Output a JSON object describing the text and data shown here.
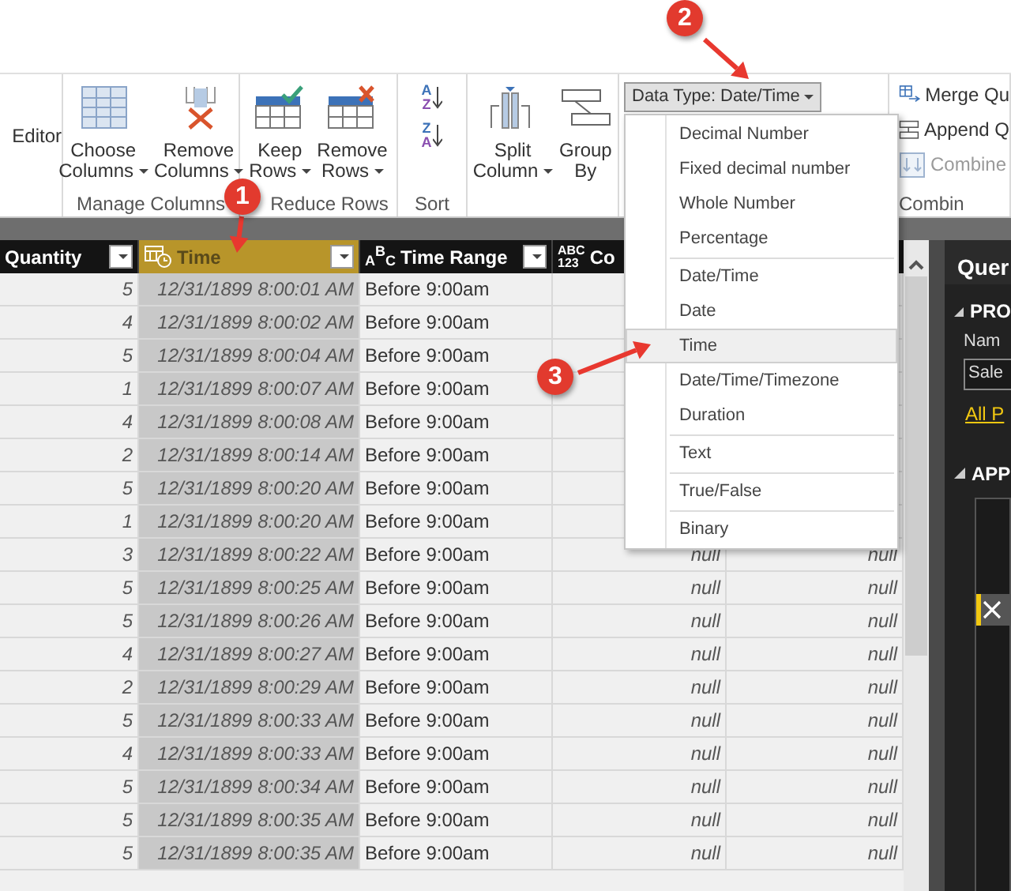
{
  "ribbon": {
    "editor_label": "Editor",
    "groups": [
      {
        "kind": "buttons",
        "label": "Manage Columns",
        "buttons": [
          {
            "kind": "choose-columns",
            "lines": [
              "Choose",
              "Columns"
            ],
            "dropdown": true
          },
          {
            "kind": "remove-columns",
            "lines": [
              "Remove",
              "Columns"
            ],
            "dropdown": true
          }
        ]
      },
      {
        "kind": "buttons",
        "label": "Reduce Rows",
        "buttons": [
          {
            "kind": "keep-rows",
            "lines": [
              "Keep",
              "Rows"
            ],
            "dropdown": true
          },
          {
            "kind": "remove-rows",
            "lines": [
              "Remove",
              "Rows"
            ],
            "dropdown": true
          }
        ]
      },
      {
        "kind": "sort",
        "label": "Sort",
        "buttons": [
          {
            "top": "A",
            "bottom": "Z"
          },
          {
            "top": "Z",
            "bottom": "A"
          }
        ]
      },
      {
        "kind": "buttons",
        "buttons": [
          {
            "kind": "split-column",
            "lines": [
              "Split",
              "Column"
            ],
            "dropdown": true
          },
          {
            "kind": "group-by",
            "lines": [
              "Group",
              "By"
            ],
            "dropdown": false
          }
        ]
      },
      {
        "kind": "data-type",
        "label": "Data Type: Date/Time",
        "open": true,
        "menu": [
          {
            "items": [
              {
                "label": "Decimal Number",
                "selected": false
              },
              {
                "label": "Fixed decimal number",
                "selected": false
              },
              {
                "label": "Whole Number",
                "selected": false
              },
              {
                "label": "Percentage",
                "selected": false
              }
            ]
          },
          {
            "items": [
              {
                "label": "Date/Time",
                "selected": false
              },
              {
                "label": "Date",
                "selected": false
              },
              {
                "label": "Time",
                "selected": true
              },
              {
                "label": "Date/Time/Timezone",
                "selected": false
              },
              {
                "label": "Duration",
                "selected": false
              }
            ]
          },
          {
            "items": [
              {
                "label": "Text",
                "selected": false
              }
            ]
          },
          {
            "items": [
              {
                "label": "True/False",
                "selected": false
              }
            ]
          },
          {
            "items": [
              {
                "label": "Binary",
                "selected": false
              }
            ]
          }
        ]
      },
      {
        "kind": "list",
        "label": "Combin",
        "items": [
          {
            "kind": "merge",
            "label": "Merge Qu",
            "disabled": false
          },
          {
            "kind": "append",
            "label": "Append Q",
            "disabled": false
          },
          {
            "kind": "combine",
            "label": "Combine",
            "disabled": true
          }
        ]
      }
    ]
  },
  "table": {
    "columns": [
      {
        "label": "Quantity",
        "kind": "none",
        "selected": false
      },
      {
        "label": "Time",
        "kind": "time",
        "selected": true
      },
      {
        "label": "Time Range",
        "kind": "text",
        "type_label": [
          "A",
          "B",
          "C"
        ],
        "selected": false
      },
      {
        "label": "Co",
        "kind": "any",
        "type_label": [
          "ABC",
          "123"
        ],
        "selected": false
      }
    ],
    "rows": [
      {
        "quantity": "5",
        "time": "12/31/1899 8:00:01 AM",
        "time_range": "Before 9:00am"
      },
      {
        "quantity": "4",
        "time": "12/31/1899 8:00:02 AM",
        "time_range": "Before 9:00am"
      },
      {
        "quantity": "5",
        "time": "12/31/1899 8:00:04 AM",
        "time_range": "Before 9:00am"
      },
      {
        "quantity": "1",
        "time": "12/31/1899 8:00:07 AM",
        "time_range": "Before 9:00am"
      },
      {
        "quantity": "4",
        "time": "12/31/1899 8:00:08 AM",
        "time_range": "Before 9:00am"
      },
      {
        "quantity": "2",
        "time": "12/31/1899 8:00:14 AM",
        "time_range": "Before 9:00am"
      },
      {
        "quantity": "5",
        "time": "12/31/1899 8:00:20 AM",
        "time_range": "Before 9:00am"
      },
      {
        "quantity": "1",
        "time": "12/31/1899 8:00:20 AM",
        "time_range": "Before 9:00am"
      },
      {
        "quantity": "3",
        "time": "12/31/1899 8:00:22 AM",
        "time_range": "Before 9:00am",
        "column_4": "null",
        "column_5": "null"
      },
      {
        "quantity": "5",
        "time": "12/31/1899 8:00:25 AM",
        "time_range": "Before 9:00am",
        "column_4": "null",
        "column_5": "null"
      },
      {
        "quantity": "5",
        "time": "12/31/1899 8:00:26 AM",
        "time_range": "Before 9:00am",
        "column_4": "null",
        "column_5": "null"
      },
      {
        "quantity": "4",
        "time": "12/31/1899 8:00:27 AM",
        "time_range": "Before 9:00am",
        "column_4": "null",
        "column_5": "null"
      },
      {
        "quantity": "2",
        "time": "12/31/1899 8:00:29 AM",
        "time_range": "Before 9:00am",
        "column_4": "null",
        "column_5": "null"
      },
      {
        "quantity": "5",
        "time": "12/31/1899 8:00:33 AM",
        "time_range": "Before 9:00am",
        "column_4": "null",
        "column_5": "null"
      },
      {
        "quantity": "4",
        "time": "12/31/1899 8:00:33 AM",
        "time_range": "Before 9:00am",
        "column_4": "null",
        "column_5": "null"
      },
      {
        "quantity": "5",
        "time": "12/31/1899 8:00:34 AM",
        "time_range": "Before 9:00am",
        "column_4": "null",
        "column_5": "null"
      },
      {
        "quantity": "5",
        "time": "12/31/1899 8:00:35 AM",
        "time_range": "Before 9:00am",
        "column_4": "null",
        "column_5": "null"
      },
      {
        "quantity": "5",
        "time": "12/31/1899 8:00:35 AM",
        "time_range": "Before 9:00am",
        "column_4": "null",
        "column_5": "null"
      }
    ]
  },
  "query_pane": {
    "title": "Quer",
    "sections": [
      {
        "label": "PRO",
        "expanded": true,
        "name_label": "Nam",
        "name_value": "Sale",
        "link": "All P"
      },
      {
        "label": "APP",
        "expanded": true,
        "steps": [
          {
            "selected": true
          }
        ]
      }
    ]
  },
  "annotations": [
    {
      "label": "1"
    },
    {
      "label": "2"
    },
    {
      "label": "3"
    }
  ]
}
